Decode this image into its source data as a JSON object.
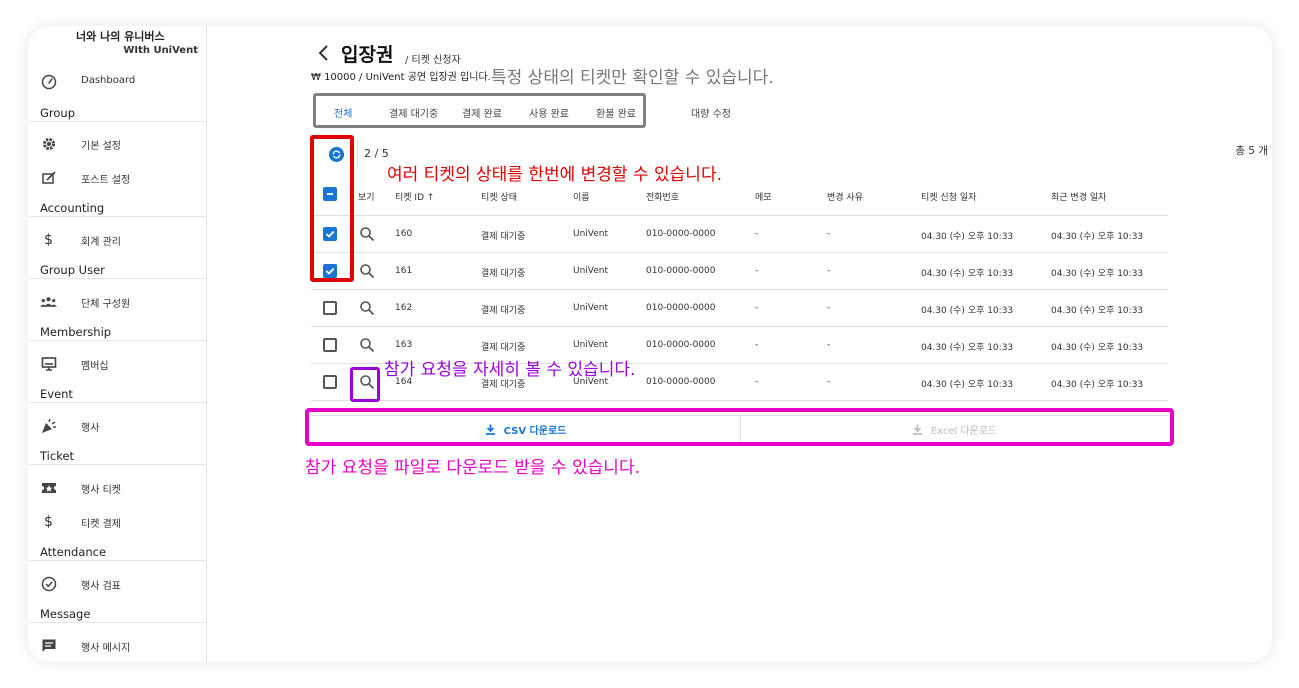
{
  "brand": {
    "line1": "너와 나의 유니버스",
    "line2": "WIth UniVent"
  },
  "sidebar": {
    "items": [
      {
        "label": "Dashboard",
        "icon": "gauge-icon"
      },
      {
        "group": "Group"
      },
      {
        "label": "기본 설정",
        "icon": "gear-icon"
      },
      {
        "label": "포스트 설정",
        "icon": "post-edit-icon"
      },
      {
        "group": "Accounting"
      },
      {
        "label": "회계 관리",
        "icon": "dollar-icon"
      },
      {
        "group": "Group User"
      },
      {
        "label": "단체 구성원",
        "icon": "people-icon"
      },
      {
        "group": "Membership"
      },
      {
        "label": "멤버십",
        "icon": "monitor-icon"
      },
      {
        "group": "Event"
      },
      {
        "label": "행사",
        "icon": "party-icon"
      },
      {
        "group": "Ticket"
      },
      {
        "label": "행사 티켓",
        "icon": "ticket-icon"
      },
      {
        "label": "티켓 결제",
        "icon": "dollar-icon"
      },
      {
        "group": "Attendance"
      },
      {
        "label": "행사 검표",
        "icon": "check-circle-icon"
      },
      {
        "group": "Message"
      },
      {
        "label": "행사 메시지",
        "icon": "message-icon"
      }
    ]
  },
  "header": {
    "title": "입장권",
    "title_sub": "/ 티켓 신청자",
    "subtitle": "₩ 10000 / UniVent 공연 입장권 입니다."
  },
  "tabs": [
    {
      "label": "전체",
      "active": true
    },
    {
      "label": "결제 대기중"
    },
    {
      "label": "결제 완료"
    },
    {
      "label": "사용 완료"
    },
    {
      "label": "환불 완료"
    },
    {
      "label": "대량 수정"
    }
  ],
  "selection": {
    "count_text": "2 / 5",
    "total_text": "총 5 개"
  },
  "table": {
    "columns": [
      "보기",
      "티켓 ID ↑",
      "티켓 상태",
      "이름",
      "전화번호",
      "메모",
      "변경 사유",
      "티켓 신청 일자",
      "최근 변경 일자"
    ],
    "rows": [
      {
        "checked": true,
        "id": "160",
        "status": "결제 대기중",
        "name": "UniVent",
        "phone": "010-0000-0000",
        "memo": "-",
        "reason": "-",
        "applied": "04.30 (수) 오후 10:33",
        "updated": "04.30 (수) 오후 10:33"
      },
      {
        "checked": true,
        "id": "161",
        "status": "결제 대기중",
        "name": "UniVent",
        "phone": "010-0000-0000",
        "memo": "-",
        "reason": "-",
        "applied": "04.30 (수) 오후 10:33",
        "updated": "04.30 (수) 오후 10:33"
      },
      {
        "checked": false,
        "id": "162",
        "status": "결제 대기중",
        "name": "UniVent",
        "phone": "010-0000-0000",
        "memo": "-",
        "reason": "-",
        "applied": "04.30 (수) 오후 10:33",
        "updated": "04.30 (수) 오후 10:33"
      },
      {
        "checked": false,
        "id": "163",
        "status": "결제 대기중",
        "name": "UniVent",
        "phone": "010-0000-0000",
        "memo": "-",
        "reason": "-",
        "applied": "04.30 (수) 오후 10:33",
        "updated": "04.30 (수) 오후 10:33"
      },
      {
        "checked": false,
        "id": "164",
        "status": "결제 대기중",
        "name": "UniVent",
        "phone": "010-0000-0000",
        "memo": "-",
        "reason": "-",
        "applied": "04.30 (수) 오후 10:33",
        "updated": "04.30 (수) 오후 10:33"
      }
    ]
  },
  "downloads": {
    "csv": "CSV 다운로드",
    "excel": "Excel 다운로드"
  },
  "annotations": {
    "tabs_note": "특정 상태의 티켓만 확인할 수 있습니다.",
    "bulk_note": "여러 티켓의 상태를 한번에 변경할 수 있습니다.",
    "detail_note": "참가 요청을 자세히 볼 수 있습니다.",
    "download_note": "참가 요청을 파일로 다운로드 받을 수 있습니다."
  },
  "colors": {
    "accent": "#1976d2",
    "red": "#e00000",
    "purple": "#9b00e0",
    "pink": "#e800c6",
    "gray_box": "#808080"
  }
}
